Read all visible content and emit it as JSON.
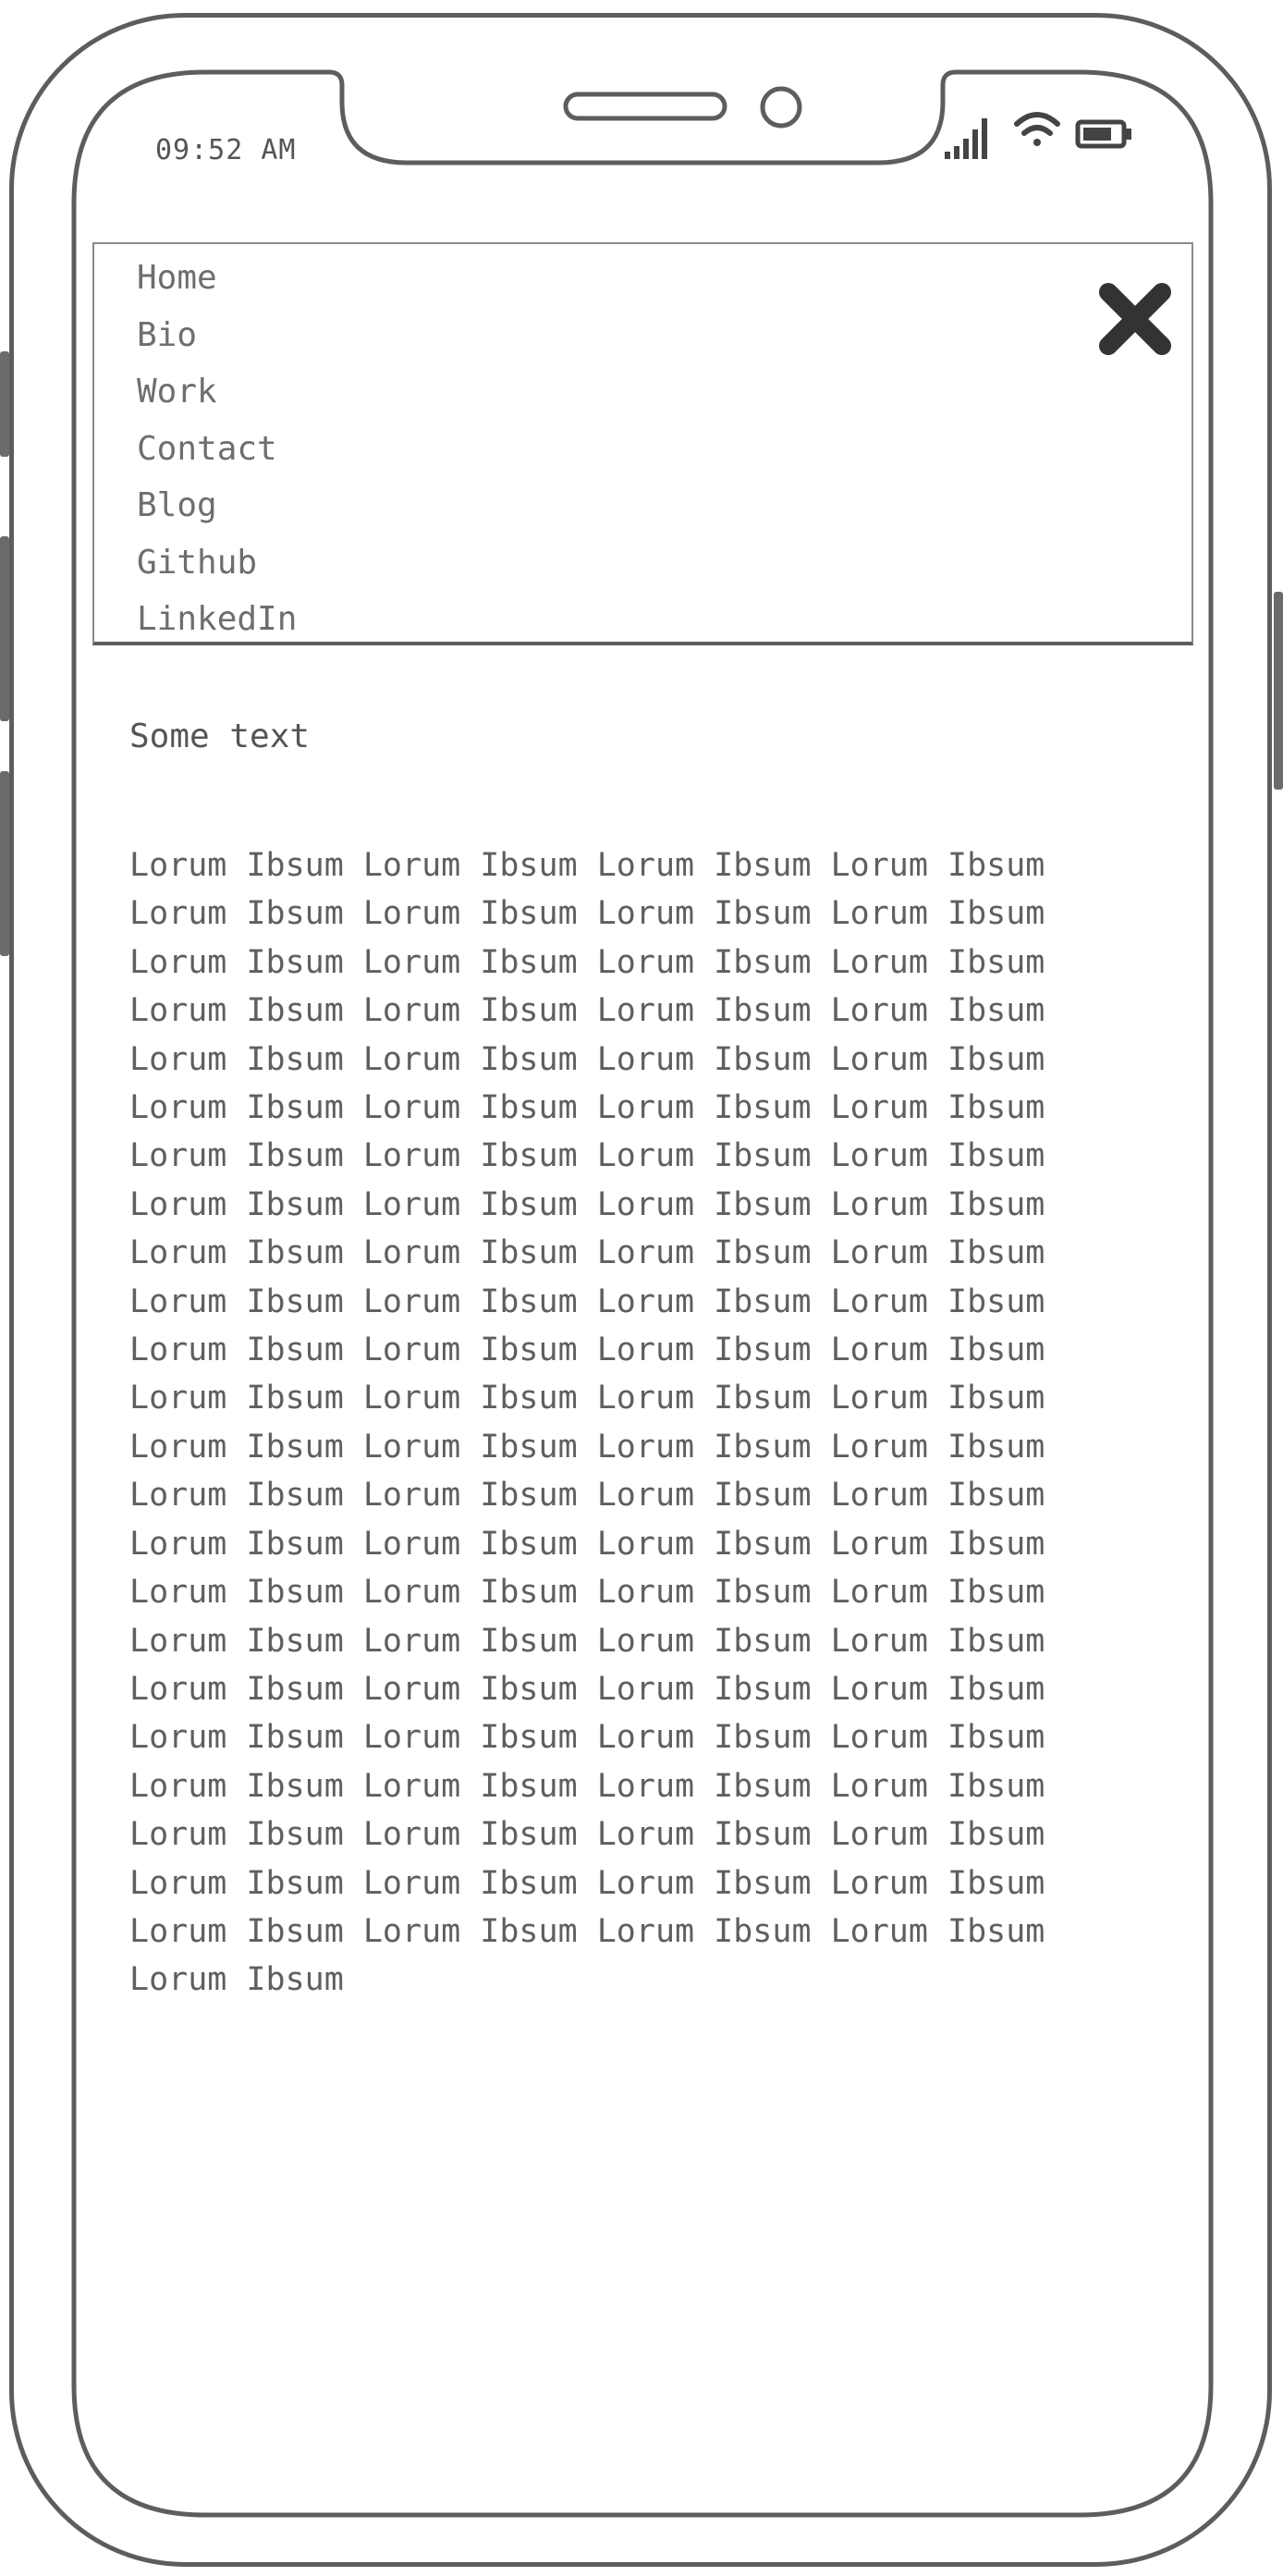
{
  "status_bar": {
    "time": "09:52 AM",
    "icons": [
      "signal-icon",
      "wifi-icon",
      "battery-icon"
    ]
  },
  "menu": {
    "items": [
      {
        "label": "Home"
      },
      {
        "label": "Bio"
      },
      {
        "label": "Work"
      },
      {
        "label": "Contact"
      },
      {
        "label": "Blog"
      },
      {
        "label": "Github"
      },
      {
        "label": "LinkedIn"
      }
    ],
    "close_icon": "close-icon"
  },
  "content": {
    "heading": "Some text",
    "body": "Lorum Ibsum Lorum Ibsum Lorum Ibsum Lorum Ibsum Lorum Ibsum Lorum Ibsum Lorum Ibsum Lorum Ibsum Lorum Ibsum Lorum Ibsum Lorum Ibsum Lorum Ibsum Lorum Ibsum Lorum Ibsum Lorum Ibsum Lorum Ibsum Lorum Ibsum Lorum Ibsum Lorum Ibsum Lorum Ibsum Lorum Ibsum Lorum Ibsum Lorum Ibsum Lorum Ibsum Lorum Ibsum Lorum Ibsum Lorum Ibsum Lorum Ibsum Lorum Ibsum Lorum Ibsum Lorum Ibsum Lorum Ibsum Lorum Ibsum Lorum Ibsum Lorum Ibsum Lorum Ibsum Lorum Ibsum Lorum Ibsum Lorum Ibsum Lorum Ibsum Lorum Ibsum Lorum Ibsum Lorum Ibsum Lorum Ibsum Lorum Ibsum Lorum Ibsum Lorum Ibsum Lorum Ibsum Lorum Ibsum Lorum Ibsum Lorum Ibsum Lorum Ibsum Lorum Ibsum Lorum Ibsum Lorum Ibsum Lorum Ibsum Lorum Ibsum Lorum Ibsum Lorum Ibsum Lorum Ibsum Lorum Ibsum Lorum Ibsum Lorum Ibsum Lorum Ibsum Lorum Ibsum Lorum Ibsum Lorum Ibsum Lorum Ibsum Lorum Ibsum Lorum Ibsum Lorum Ibsum Lorum Ibsum Lorum Ibsum Lorum Ibsum Lorum Ibsum Lorum Ibsum Lorum Ibsum Lorum Ibsum Lorum Ibsum Lorum Ibsum Lorum Ibsum Lorum Ibsum Lorum Ibsum Lorum Ibsum Lorum Ibsum Lorum Ibsum Lorum Ibsum Lorum Ibsum Lorum Ibsum Lorum Ibsum Lorum Ibsum Lorum Ibsum Lorum Ibsum"
  },
  "colors": {
    "frame": "#5d5d5d",
    "text": "#5f5f5f",
    "menu_text": "#6e6e6e",
    "close": "#333333"
  }
}
